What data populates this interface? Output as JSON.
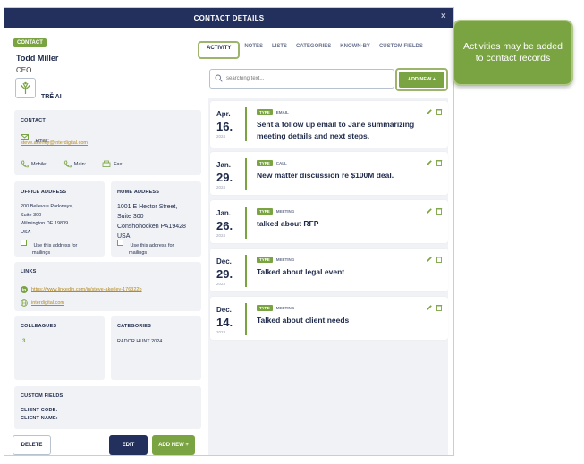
{
  "modal": {
    "title": "CONTACT DETAILS",
    "close": "×"
  },
  "contact": {
    "badge": "CONTACT",
    "name": "Todd Miller",
    "title": "CEO",
    "company": "TRĚ AI"
  },
  "contact_card": {
    "heading": "CONTACT",
    "email_label": "Email:",
    "email": "steve.akerley@interdigital.com",
    "mobile_label": "Mobile:",
    "main_label": "Main:",
    "fax_label": "Fax:"
  },
  "office_address": {
    "heading": "OFFICE ADDRESS",
    "lines": [
      "200 Bellevue Parkways,",
      "Suite 300",
      "Wilmington DE 19809",
      "USA"
    ],
    "use_label_1": "Use this address for",
    "use_label_2": "mailings"
  },
  "home_address": {
    "heading": "HOME ADDRESS",
    "lines": [
      "1001 E Hector Street,",
      "Suite 300",
      "Conshohocken PA19428",
      "USA"
    ],
    "use_label_1": "Use this address for",
    "use_label_2": "mailings"
  },
  "links": {
    "heading": "LINKS",
    "linkedin": "https://www.linkedin.com/in/steve-akerley-176322b",
    "website": "interdigital.com"
  },
  "colleagues": {
    "heading": "COLLEAGUES",
    "count": "3"
  },
  "categories": {
    "heading": "CATEGORIES",
    "value": "RADOR HUNT 2024"
  },
  "custom_fields": {
    "heading": "CUSTOM FIELDS",
    "client_code": "CLIENT CODE:",
    "client_name": "CLIENT NAME:"
  },
  "buttons": {
    "delete": "DELETE",
    "edit": "EDIT",
    "add_new": "ADD NEW +"
  },
  "tabs": [
    "ACTIVITY",
    "NOTES",
    "LISTS",
    "CATEGORIES",
    "KNOWN-BY",
    "CUSTOM FIELDS"
  ],
  "search": {
    "placeholder": "searching text...",
    "add_new": "ADD NEW +"
  },
  "activities": [
    {
      "month": "Apr.",
      "day": "16.",
      "year": "2024",
      "type_label": "TYPE",
      "type": "EMAIL",
      "text": "Sent a follow up email to Jane summarizing meeting details and next steps."
    },
    {
      "month": "Jan.",
      "day": "29.",
      "year": "2024",
      "type_label": "TYPE",
      "type": "CALL",
      "text": "New matter discussion re $100M deal."
    },
    {
      "month": "Jan.",
      "day": "26.",
      "year": "2024",
      "type_label": "TYPE",
      "type": "MEETING",
      "text": "talked about RFP"
    },
    {
      "month": "Dec.",
      "day": "29.",
      "year": "2023",
      "type_label": "TYPE",
      "type": "MEETING",
      "text": "Talked about legal event"
    },
    {
      "month": "Dec.",
      "day": "14.",
      "year": "2023",
      "type_label": "TYPE",
      "type": "MEETING",
      "text": "Talked about client needs"
    }
  ],
  "callout": {
    "text": "Activities may be added to contact records"
  },
  "colors": {
    "header": "#232f5c",
    "accent": "#7aa341",
    "link": "#b58a1f"
  }
}
